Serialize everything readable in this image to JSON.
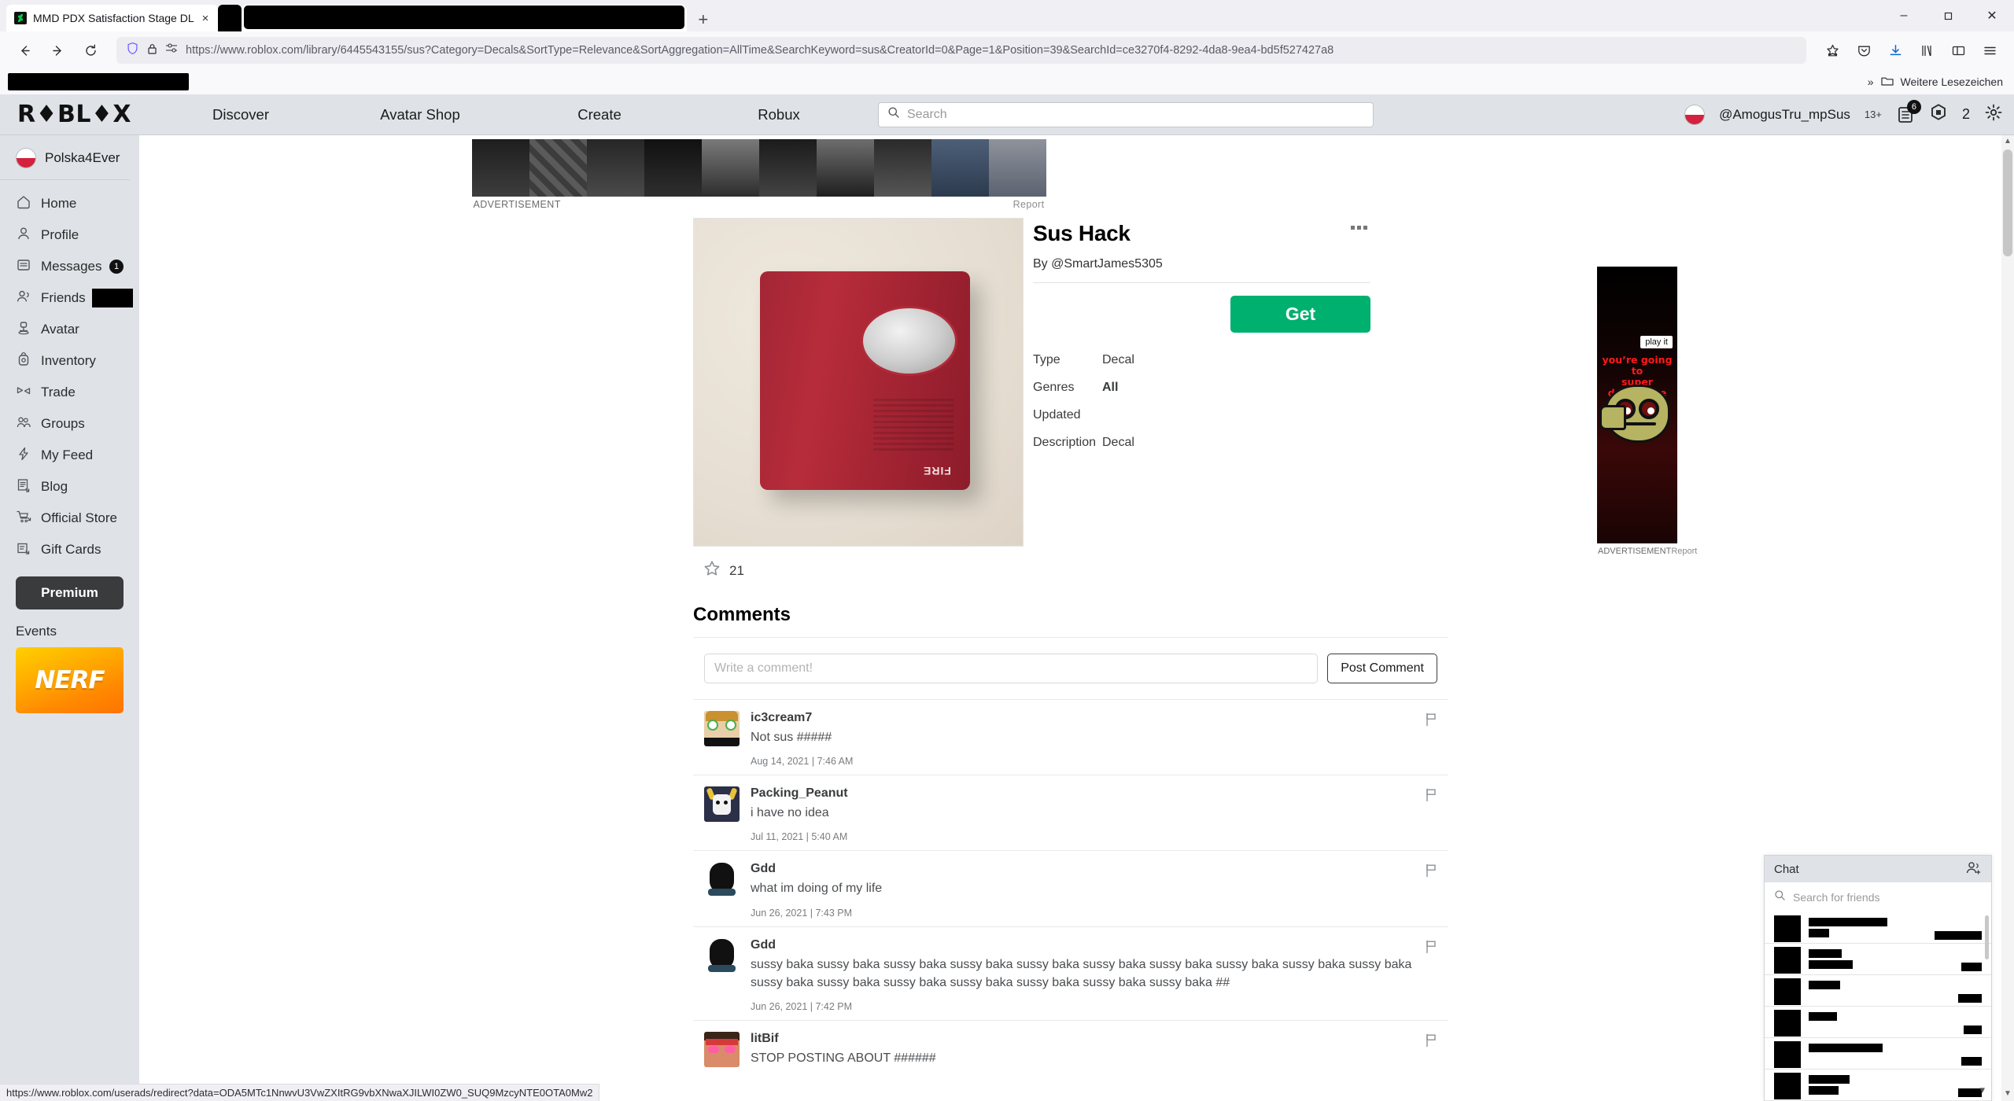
{
  "browser": {
    "tab": {
      "title": "MMD PDX Satisfaction Stage DL",
      "favicon_name": "deviantart-icon",
      "close_label": "×"
    },
    "new_tab_label": "+",
    "window_controls": {
      "minimize": "–",
      "maximize": "❐",
      "close": "✕"
    },
    "nav": {
      "back": "←",
      "forward": "→",
      "reload": "⟳"
    },
    "url": {
      "host": "https://www.roblox.com",
      "path": "/library/6445543155/sus?Category=Decals&SortType=Relevance&SortAggregation=AllTime&SearchKeyword=sus&CreatorId=0&Page=1&Position=39&SearchId=ce3270f4-8292-4da8-9ea4-bd5f527427a8",
      "full": "https://www.roblox.com/library/6445543155/sus?Category=Decals&SortType=Relevance&SortAggregation=AllTime&SearchKeyword=sus&CreatorId=0&Page=1&Position=39&SearchId=ce3270f4-8292-4da8-9ea4-bd5f527427a8"
    },
    "toolbar_icons": [
      "bookmark-star-icon",
      "pocket-icon",
      "downloads-icon",
      "library-icon",
      "sidebar-icon",
      "menu-icon"
    ],
    "bookmarks_bar": {
      "overflow_label": "»",
      "folder_label": "Weitere Lesezeichen"
    },
    "status_url": "https://www.roblox.com/userads/redirect?data=ODA5MTc1NnwvU3VwZXItRG9vbXNwaXJILWI0ZW0_SUQ9MzcyNTE0OTA0Mw2"
  },
  "roblox": {
    "logo": "R♦BL♦X",
    "nav": [
      {
        "label": "Discover"
      },
      {
        "label": "Avatar Shop"
      },
      {
        "label": "Create"
      },
      {
        "label": "Robux"
      }
    ],
    "search": {
      "placeholder": "Search",
      "value": "",
      "icon": "search-icon"
    },
    "account": {
      "username": "@AmogusTru_mpSus",
      "age_tag": "13+",
      "messages_badge": "6",
      "robux_count": "2",
      "settings_icon": "gear-icon",
      "messages_icon": "messages-icon",
      "robux_icon": "robux-icon",
      "avatar_icon": "poland-flag-avatar"
    }
  },
  "sidebar": {
    "user": {
      "name": "Polska4Ever",
      "avatar_icon": "poland-flag-avatar"
    },
    "items": [
      {
        "label": "Home",
        "icon": "home-icon"
      },
      {
        "label": "Profile",
        "icon": "person-icon"
      },
      {
        "label": "Messages",
        "icon": "envelope-icon",
        "badge": "1"
      },
      {
        "label": "Friends",
        "icon": "people-icon",
        "redacted": true
      },
      {
        "label": "Avatar",
        "icon": "avatar-icon"
      },
      {
        "label": "Inventory",
        "icon": "backpack-icon"
      },
      {
        "label": "Trade",
        "icon": "trade-icon"
      },
      {
        "label": "Groups",
        "icon": "groups-icon"
      },
      {
        "label": "My Feed",
        "icon": "feed-bolt-icon"
      },
      {
        "label": "Blog",
        "icon": "blog-icon"
      },
      {
        "label": "Official Store",
        "icon": "cart-icon"
      },
      {
        "label": "Gift Cards",
        "icon": "giftcard-icon"
      }
    ],
    "premium_label": "Premium",
    "events_label": "Events",
    "event_ad": {
      "brand": "NERF"
    }
  },
  "top_ad": {
    "label": "ADVERTISEMENT",
    "report": "Report"
  },
  "item": {
    "title": "Sus Hack",
    "by_label": "By",
    "creator": "@SmartJames5305",
    "get_button": "Get",
    "more_icon": "more-options-icon",
    "favorites": {
      "count": "21",
      "icon": "star-icon"
    },
    "details": [
      {
        "key": "Type",
        "value": "Decal",
        "bold": false
      },
      {
        "key": "Genres",
        "value": "All",
        "bold": true
      },
      {
        "key": "Updated",
        "value": "",
        "bold": false
      },
      {
        "key": "Description",
        "value": "Decal",
        "bold": false
      }
    ],
    "thumbnail": {
      "alt": "red fire alarm strobe on wall",
      "word": "FIRE"
    }
  },
  "comments": {
    "heading": "Comments",
    "input_placeholder": "Write a comment!",
    "input_value": "",
    "post_label": "Post Comment",
    "flag_icon": "report-flag-icon",
    "list": [
      {
        "user": "ic3cream7",
        "text": "Not sus #####",
        "date": "Aug 14, 2021 | 7:46 AM",
        "avatar": "ic3cream7-avatar"
      },
      {
        "user": "Packing_Peanut",
        "text": "i have no idea",
        "date": "Jul 11, 2021 | 5:40 AM",
        "avatar": "packing-peanut-avatar"
      },
      {
        "user": "Gdd",
        "text": "what im doing of my life",
        "date": "Jun 26, 2021 | 7:43 PM",
        "avatar": "gdd-avatar"
      },
      {
        "user": "Gdd",
        "text": "sussy baka sussy baka sussy baka sussy baka sussy baka sussy baka sussy baka sussy baka sussy baka sussy baka sussy baka sussy baka sussy baka sussy baka sussy baka sussy baka sussy baka ##",
        "date": "Jun 26, 2021 | 7:42 PM",
        "avatar": "gdd-avatar"
      },
      {
        "user": "litBif",
        "text": "STOP POSTING ABOUT ######",
        "date": "",
        "avatar": "litbif-avatar"
      }
    ]
  },
  "rail_ad": {
    "play_label": "play it",
    "headline_line1": "you’re going to",
    "headline_line2": "super doomspire",
    "label": "ADVERTISEMENT",
    "report": "Report"
  },
  "chat": {
    "title": "Chat",
    "add_friend_icon": "add-friend-icon",
    "search_placeholder": "Search for friends",
    "search_value": "",
    "search_icon": "search-icon",
    "collapse_icon": "chevron-down-icon",
    "rows": [
      {
        "redacted": true
      },
      {
        "redacted": true
      },
      {
        "redacted": true
      },
      {
        "redacted": true
      },
      {
        "redacted": true
      },
      {
        "redacted": true
      }
    ]
  },
  "colors": {
    "roblox_green": "#00b06f",
    "header_gray": "#dfe3e8",
    "ad_red": "#ff1a1a"
  }
}
